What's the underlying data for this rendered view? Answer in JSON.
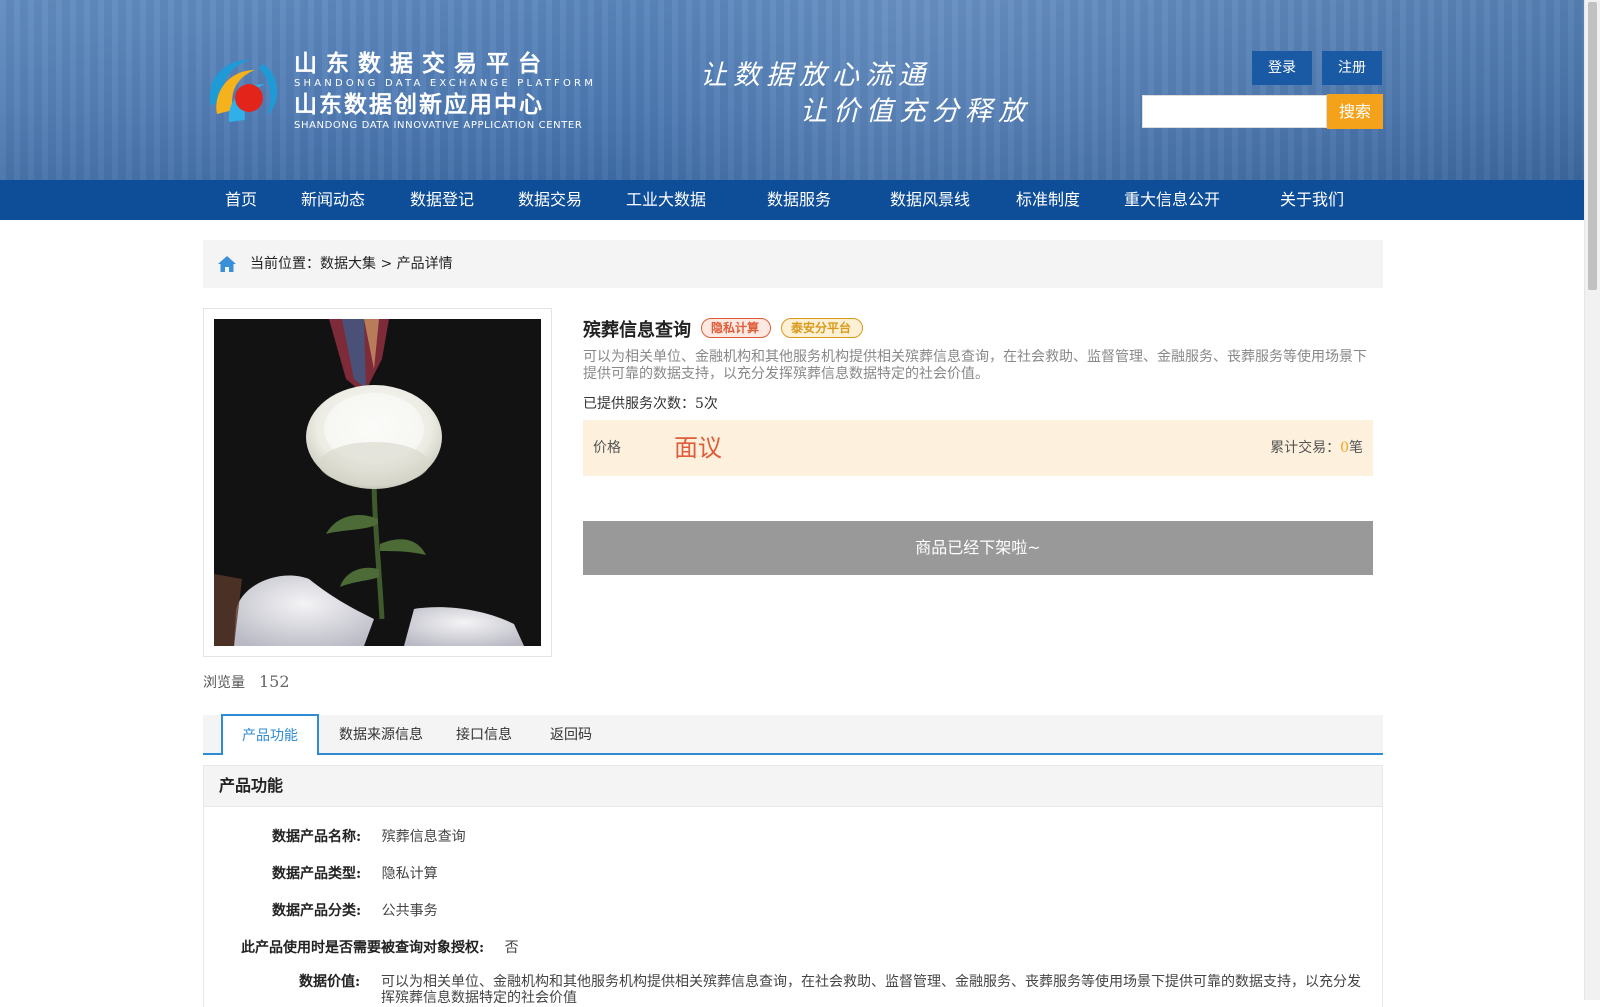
{
  "header": {
    "brand_title_1": "山东数据交易平台",
    "brand_sub_1": "SHANDONG DATA EXCHANGE PLATFORM",
    "brand_title_2": "山东数据创新应用中心",
    "brand_sub_2": "SHANDONG DATA INNOVATIVE APPLICATION CENTER",
    "slogan_line_1": "让数据放心流通",
    "slogan_line_2": "让价值充分释放",
    "login_label": "登录",
    "register_label": "注册",
    "search_value": "",
    "search_button_label": "搜索"
  },
  "nav": {
    "items": [
      "首页",
      "新闻动态",
      "数据登记",
      "数据交易",
      "工业大数据",
      "数据服务",
      "数据风景线",
      "标准制度",
      "重大信息公开",
      "关于我们"
    ]
  },
  "breadcrumb": {
    "prefix": "当前位置：",
    "items": [
      "数据大集",
      "产品详情"
    ],
    "separator": " > "
  },
  "product": {
    "views_label": "浏览量",
    "views_count": "152",
    "title": "殡葬信息查询",
    "tags": [
      "隐私计算",
      "泰安分平台"
    ],
    "description": "可以为相关单位、金融机构和其他服务机构提供相关殡葬信息查询，在社会救助、监督管理、金融服务、丧葬服务等使用场景下提供可靠的数据支持，以充分发挥殡葬信息数据特定的社会价值。",
    "served_label": "已提供服务次数：",
    "served_count": "5次",
    "price_label": "价格",
    "price_value": "面议",
    "deals_label": "累计交易：",
    "deals_count": "0",
    "deals_unit": "笔",
    "offline_text": "商品已经下架啦~"
  },
  "tabs": [
    {
      "label": "产品功能",
      "active": true
    },
    {
      "label": "数据来源信息",
      "active": false
    },
    {
      "label": "接口信息",
      "active": false
    },
    {
      "label": "返回码",
      "active": false
    }
  ],
  "section": {
    "title": "产品功能",
    "fields": [
      {
        "label": "数据产品名称:",
        "value": "殡葬信息查询"
      },
      {
        "label": "数据产品类型:",
        "value": "隐私计算"
      },
      {
        "label": "数据产品分类:",
        "value": "公共事务"
      },
      {
        "label": "此产品使用时是否需要被查询对象授权:",
        "value": "否"
      },
      {
        "label": "数据价值:",
        "value": "可以为相关单位、金融机构和其他服务机构提供相关殡葬信息查询，在社会救助、监督管理、金融服务、丧葬服务等使用场景下提供可靠的数据支持，以充分发挥殡葬信息数据特定的社会价值"
      }
    ]
  },
  "colors": {
    "nav_bg": "#0e4d98",
    "header_btn": "#1a5aa5",
    "search_btn": "#f5a21b",
    "price_red": "#e05d3a",
    "tab_accent": "#2f8bd3",
    "offline_btn": "#999999"
  },
  "icons": [
    "logo-swirl-icon",
    "home-icon"
  ]
}
